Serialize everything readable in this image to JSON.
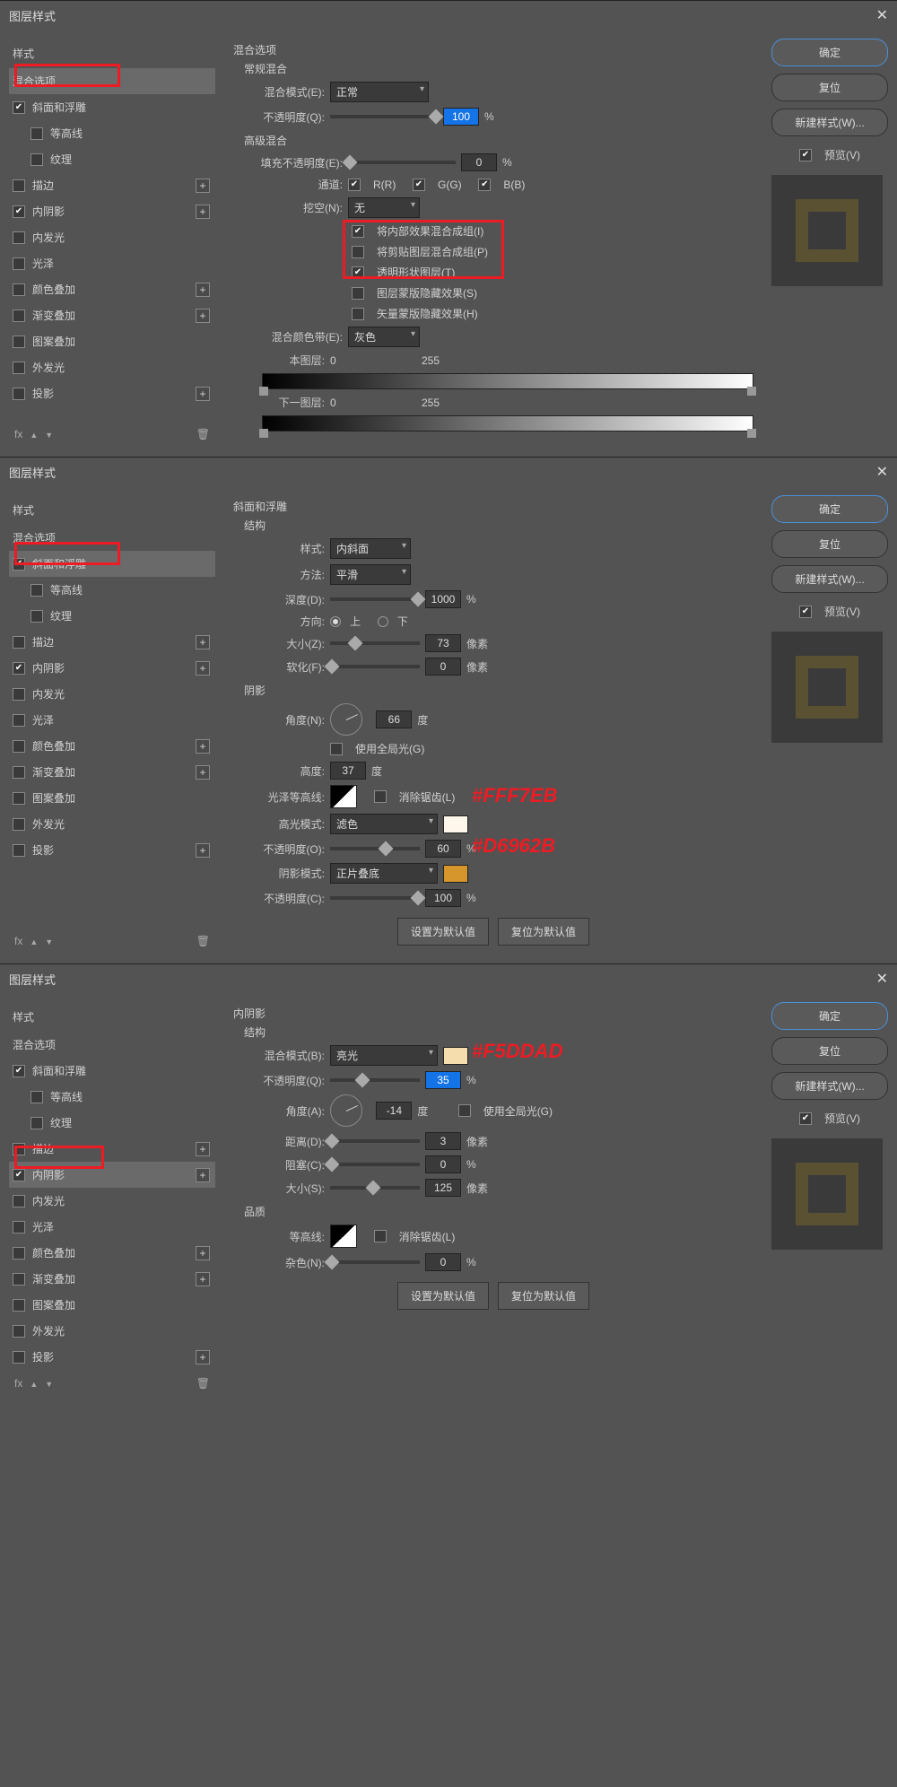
{
  "dialog_title": "图层样式",
  "close_glyph": "✕",
  "styles_header": "样式",
  "blend_options_label": "混合选项",
  "style_items": [
    {
      "label": "斜面和浮雕",
      "checked": true,
      "plus": false
    },
    {
      "label": "等高线",
      "checked": false,
      "indent": true
    },
    {
      "label": "纹理",
      "checked": false,
      "indent": true
    },
    {
      "label": "描边",
      "checked": false,
      "plus": true
    },
    {
      "label": "内阴影",
      "checked": true,
      "plus": true
    },
    {
      "label": "内发光",
      "checked": false,
      "plus": false
    },
    {
      "label": "光泽",
      "checked": false,
      "plus": false
    },
    {
      "label": "颜色叠加",
      "checked": false,
      "plus": true
    },
    {
      "label": "渐变叠加",
      "checked": false,
      "plus": true
    },
    {
      "label": "图案叠加",
      "checked": false,
      "plus": false
    },
    {
      "label": "外发光",
      "checked": false,
      "plus": false
    },
    {
      "label": "投影",
      "checked": false,
      "plus": true
    }
  ],
  "fx_label": "fx",
  "trash_glyph": "🗑",
  "buttons": {
    "ok": "确定",
    "cancel": "复位",
    "new_style": "新建样式(W)...",
    "preview": "预览(V)"
  },
  "panelA": {
    "section": "混合选项",
    "normal_blend": "常规混合",
    "blend_mode_label": "混合模式(E):",
    "blend_mode_value": "正常",
    "opacity_label": "不透明度(Q):",
    "opacity_value": "100",
    "pct": "%",
    "adv_blend": "高级混合",
    "fill_opacity_label": "填充不透明度(E):",
    "fill_opacity_value": "0",
    "channels_label": "通道:",
    "ch_r": "R(R)",
    "ch_g": "G(G)",
    "ch_b": "B(B)",
    "knockout_label": "挖空(N):",
    "knockout_value": "无",
    "opt1": "将内部效果混合成组(I)",
    "opt2": "将剪贴图层混合成组(P)",
    "opt3": "透明形状图层(T)",
    "opt4": "图层蒙版隐藏效果(S)",
    "opt5": "矢量蒙版隐藏效果(H)",
    "blend_color_band_label": "混合颜色带(E):",
    "blend_color_band_value": "灰色",
    "this_layer": "本图层:",
    "next_layer": "下一图层:",
    "range_lo": "0",
    "range_hi": "255"
  },
  "panelB": {
    "section": "斜面和浮雕",
    "structure": "结构",
    "style_label": "样式:",
    "style_value": "内斜面",
    "technique_label": "方法:",
    "technique_value": "平滑",
    "depth_label": "深度(D):",
    "depth_value": "1000",
    "pct": "%",
    "direction_label": "方向:",
    "direction_up": "上",
    "direction_down": "下",
    "size_label": "大小(Z):",
    "size_value": "73",
    "px": "像素",
    "soften_label": "软化(F):",
    "soften_value": "0",
    "shading": "阴影",
    "angle_label": "角度(N):",
    "angle_value": "66",
    "deg": "度",
    "global_light": "使用全局光(G)",
    "altitude_label": "高度:",
    "altitude_value": "37",
    "gloss_contour_label": "光泽等高线:",
    "antialias": "消除锯齿(L)",
    "highlight_mode_label": "高光模式:",
    "highlight_mode_value": "滤色",
    "highlight_opacity_label": "不透明度(O):",
    "highlight_opacity_value": "60",
    "shadow_mode_label": "阴影模式:",
    "shadow_mode_value": "正片叠底",
    "shadow_opacity_label": "不透明度(C):",
    "shadow_opacity_value": "100",
    "reset": "设置为默认值",
    "restore": "复位为默认值",
    "anno_highlight": "#FFF7EB",
    "anno_shadow": "#D6962B"
  },
  "panelC": {
    "section": "内阴影",
    "structure": "结构",
    "blend_mode_label": "混合模式(B):",
    "blend_mode_value": "亮光",
    "opacity_label": "不透明度(Q):",
    "opacity_value": "35",
    "pct": "%",
    "angle_label": "角度(A):",
    "angle_value": "-14",
    "deg": "度",
    "global_light": "使用全局光(G)",
    "distance_label": "距离(D):",
    "distance_value": "3",
    "px": "像素",
    "choke_label": "阻塞(C):",
    "choke_value": "0",
    "size_label": "大小(S):",
    "size_value": "125",
    "quality": "品质",
    "contour_label": "等高线:",
    "antialias": "消除锯齿(L)",
    "noise_label": "杂色(N):",
    "noise_value": "0",
    "reset": "设置为默认值",
    "restore": "复位为默认值",
    "anno_color": "#F5DDAD"
  }
}
